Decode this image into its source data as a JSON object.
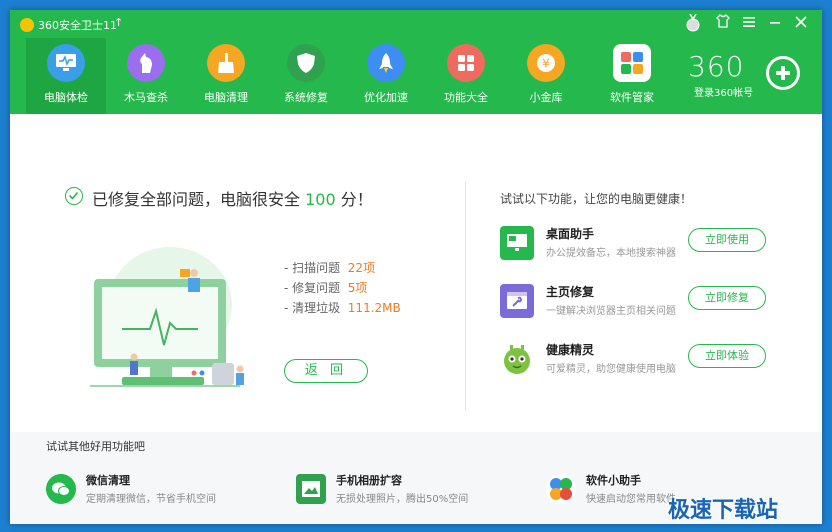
{
  "titlebar": {
    "app_title": "360安全卫士11",
    "upgrade_glyph": "↑",
    "controls": [
      "medal-icon",
      "skin-icon",
      "menu-icon",
      "minimize-icon",
      "close-icon"
    ]
  },
  "nav": {
    "items": [
      {
        "label": "电脑体检",
        "icon": "monitor-check-icon",
        "color": "#3a9ee8"
      },
      {
        "label": "木马查杀",
        "icon": "horse-icon",
        "color": "#9b6ef0"
      },
      {
        "label": "电脑清理",
        "icon": "broom-icon",
        "color": "#f5a623"
      },
      {
        "label": "系统修复",
        "icon": "shield-icon",
        "color": "#2fa14f"
      },
      {
        "label": "优化加速",
        "icon": "rocket-icon",
        "color": "#3d8ef0"
      },
      {
        "label": "功能大全",
        "icon": "grid-icon",
        "color": "#f06b5f"
      },
      {
        "label": "小金库",
        "icon": "coin-icon",
        "color": "#f5a623"
      },
      {
        "label": "软件管家",
        "icon": "apps-icon",
        "color": "#f2903a"
      }
    ],
    "active": 0
  },
  "account": {
    "brand": "360",
    "login_label": "登录360帐号"
  },
  "status": {
    "message_prefix": "已修复全部问题，电脑很安全",
    "score": "100",
    "message_suffix": "分！"
  },
  "stats": [
    {
      "label": "- 扫描问题",
      "value": "22项"
    },
    {
      "label": "- 修复问题",
      "value": "5项"
    },
    {
      "label": "- 清理垃圾",
      "value": "111.2MB"
    }
  ],
  "back_label": "返 回",
  "features": {
    "title": "试试以下功能，让您的电脑更健康！",
    "items": [
      {
        "name": "桌面助手",
        "desc": "办公提效备忘，本地搜索神器",
        "button": "立即使用",
        "icon": "desktop-icon",
        "color": "#25b84c"
      },
      {
        "name": "主页修复",
        "desc": "一键解决浏览器主页相关问题",
        "button": "立即修复",
        "icon": "wrench-icon",
        "color": "#7a6bd8"
      },
      {
        "name": "健康精灵",
        "desc": "可爱精灵，助您健康使用电脑",
        "button": "立即体验",
        "icon": "sprite-icon",
        "color": "#7dc241"
      }
    ]
  },
  "bottom": {
    "title": "试试其他好用功能吧",
    "items": [
      {
        "name": "微信清理",
        "desc": "定期清理微信，节省手机空间",
        "icon": "wechat-clean-icon",
        "color": "#25b84c"
      },
      {
        "name": "手机相册扩容",
        "desc": "无损处理照片，腾出50%空间",
        "icon": "photo-icon",
        "color": "#2fa14f"
      },
      {
        "name": "软件小助手",
        "desc": "快速启动您常用软件",
        "icon": "colorful-dots-icon",
        "color": "#e74c3c"
      }
    ]
  },
  "watermark": "极速下载站"
}
